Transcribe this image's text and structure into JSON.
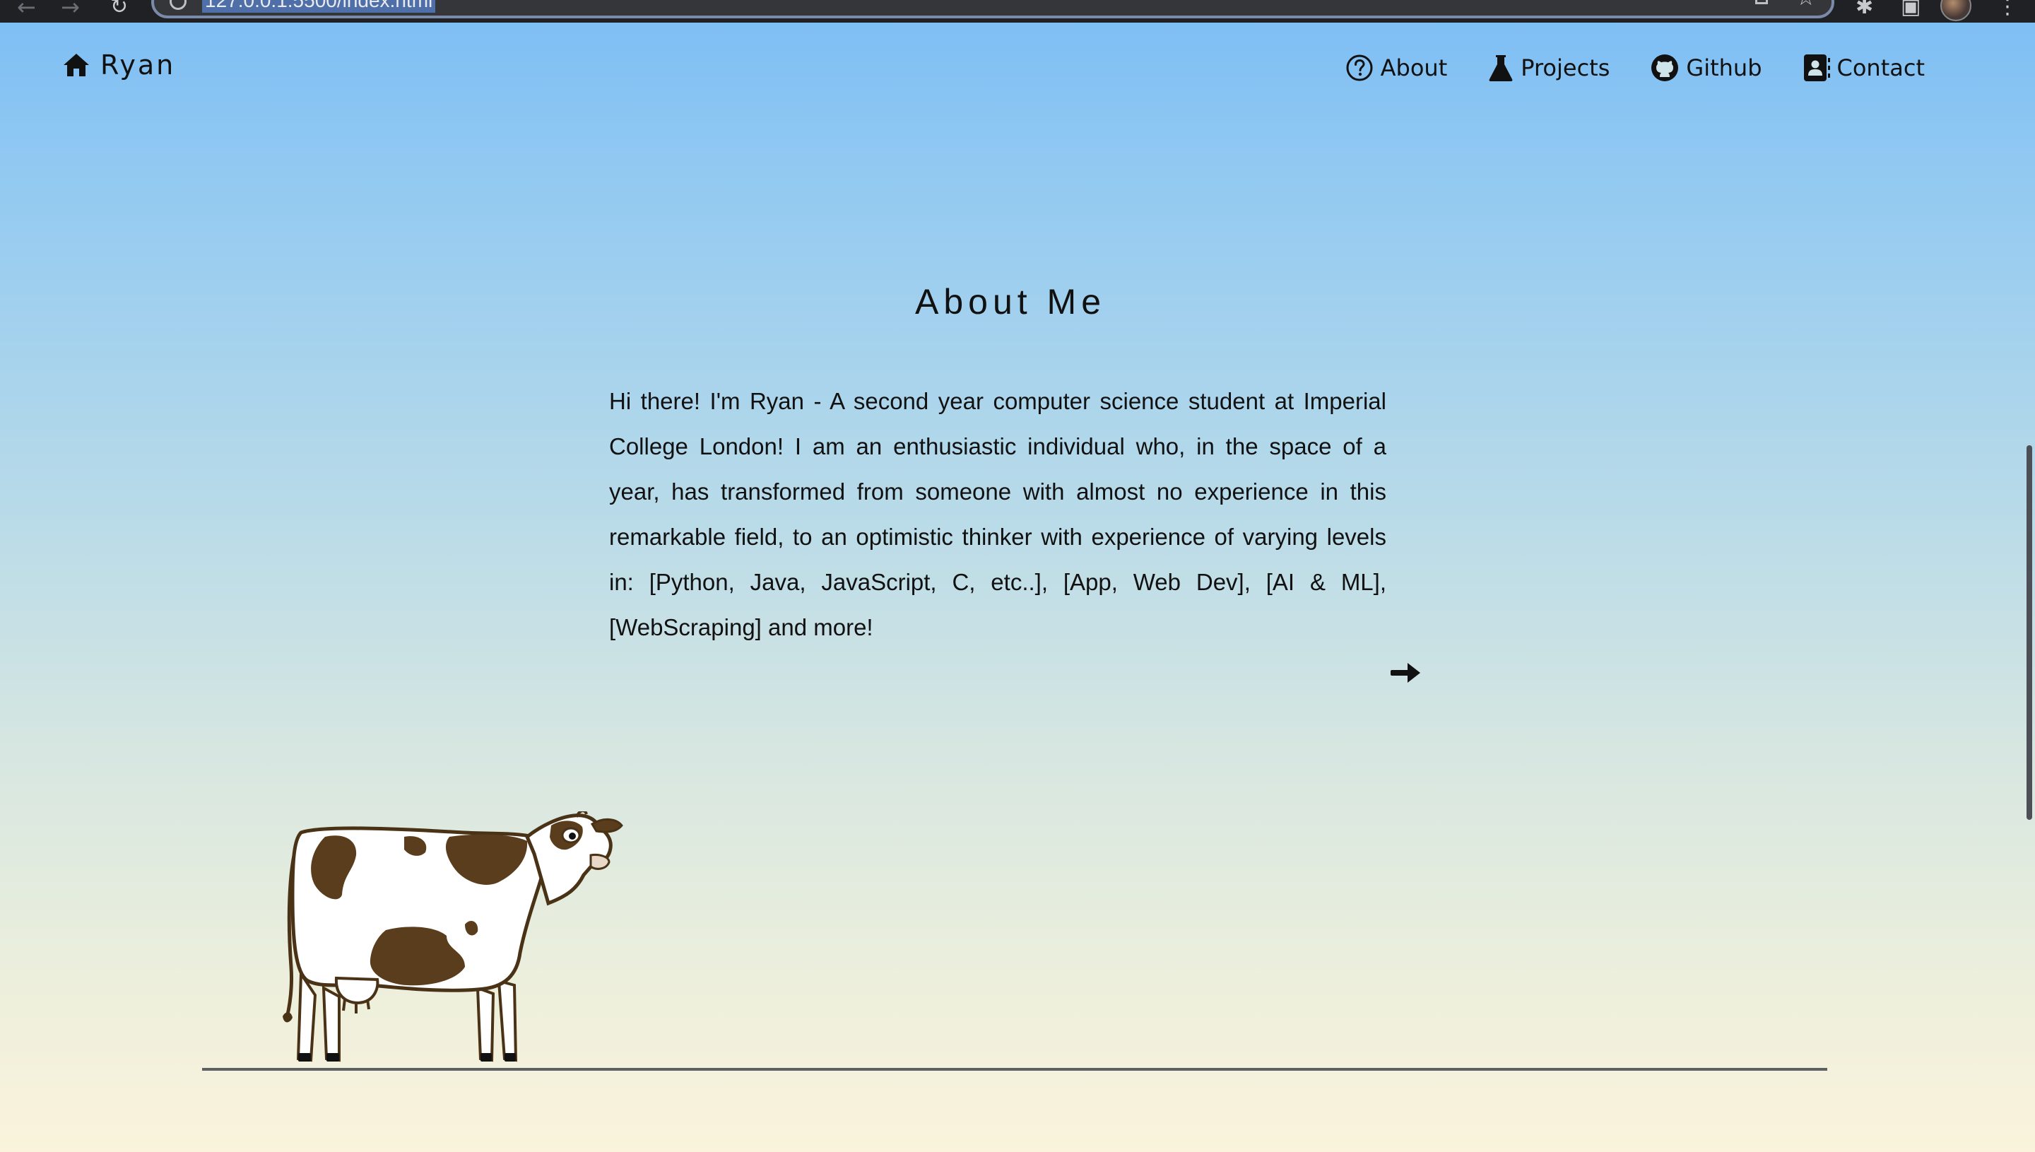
{
  "browser": {
    "url": "127.0.0.1:5500/index.html",
    "back_icon": "arrow-left",
    "forward_icon": "arrow-right",
    "reload_icon": "reload",
    "star_icon": "star",
    "menu_icon": "vertical-dots"
  },
  "nav": {
    "brand": {
      "label": "Ryan",
      "icon": "home-icon"
    },
    "links": [
      {
        "label": "About",
        "icon": "question-circle-icon"
      },
      {
        "label": "Projects",
        "icon": "flask-icon"
      },
      {
        "label": "Github",
        "icon": "github-icon"
      },
      {
        "label": "Contact",
        "icon": "contact-card-icon"
      }
    ]
  },
  "about": {
    "title": "About Me",
    "body": "Hi there! I'm Ryan - A second year computer science student at Imperial College London! I am an enthusiastic individual who, in the space of a year, has transformed from someone with almost no experience in this remarkable field, to an optimistic thinker with experience of varying levels in: [Python, Java, JavaScript, C, etc..], [App, Web Dev], [AI & ML], [WebScraping] and more!",
    "next_icon": "arrow-right-icon"
  },
  "colors": {
    "gradient_top": "#7bbdf5",
    "gradient_bottom": "#fbf3dc",
    "cow_spots": "#5a3d1c",
    "text": "#111111"
  }
}
